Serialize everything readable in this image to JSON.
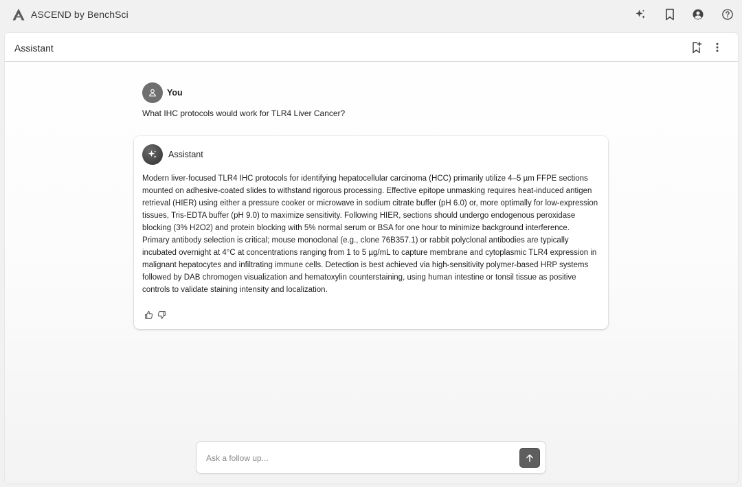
{
  "app": {
    "title": "ASCEND by BenchSci"
  },
  "panel": {
    "title": "Assistant"
  },
  "conversation": {
    "user": {
      "sender": "You",
      "message": "What IHC protocols would work for TLR4 Liver Cancer?"
    },
    "assistant": {
      "sender": "Assistant",
      "message": "Modern liver-focused TLR4 IHC protocols for identifying hepatocellular carcinoma (HCC) primarily utilize 4–5 µm FFPE sections mounted on adhesive-coated slides to withstand rigorous processing. Effective epitope unmasking requires heat-induced antigen retrieval (HIER) using either a pressure cooker or microwave in sodium citrate buffer (pH 6.0) or, more optimally for low-expression tissues, Tris-EDTA buffer (pH 9.0) to maximize sensitivity. Following HIER, sections should undergo endogenous peroxidase blocking (3% H2O2) and protein blocking with 5% normal serum or BSA for one hour to minimize background interference. Primary antibody selection is critical; mouse monoclonal (e.g., clone 76B357.1) or rabbit polyclonal antibodies are typically incubated overnight at 4°C at concentrations ranging from 1 to 5 µg/mL to capture membrane and cytoplasmic TLR4 expression in malignant hepatocytes and infiltrating immune cells. Detection is best achieved via high-sensitivity polymer-based HRP systems followed by DAB chromogen visualization and hematoxylin counterstaining, using human intestine or tonsil tissue as positive controls to validate staining intensity and localization."
    }
  },
  "composer": {
    "placeholder": "Ask a follow up...",
    "value": ""
  },
  "icons": {
    "logo": "ascend-a-logo-icon",
    "sparkle": "sparkle-icon",
    "bookmark": "bookmark-icon",
    "account": "account-circle-icon",
    "help": "help-circle-icon",
    "bookmark_add": "bookmark-add-icon",
    "more": "more-vertical-icon",
    "user": "person-icon",
    "thumbs_up": "thumbs-up-icon",
    "thumbs_down": "thumbs-down-icon",
    "send": "arrow-up-icon"
  },
  "colors": {
    "background": "#f1f1f1",
    "panel": "#ffffff",
    "text": "#1f1f1f",
    "send_button": "#5e5e5e"
  }
}
